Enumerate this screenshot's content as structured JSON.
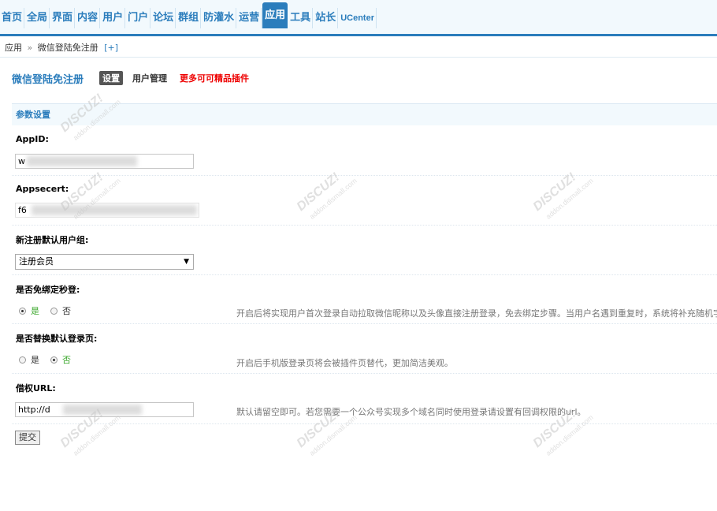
{
  "nav": {
    "items": [
      "首页",
      "全局",
      "界面",
      "内容",
      "用户",
      "门户",
      "论坛",
      "群组",
      "防灌水",
      "运营",
      "应用",
      "工具",
      "站长",
      "UCenter"
    ],
    "active": "应用"
  },
  "breadcrumb": {
    "root": "应用",
    "sep": "»",
    "current": "微信登陆免注册",
    "add": "[+]"
  },
  "plugin": {
    "title": "微信登陆免注册",
    "tab_settings": "设置",
    "tab_users": "用户管理",
    "more_link": "更多可可精品插件"
  },
  "section": {
    "title": "参数设置"
  },
  "fields": {
    "appid": {
      "label": "AppID:",
      "value": "w"
    },
    "secret": {
      "label": "Appsecert:",
      "value": "f6"
    },
    "group": {
      "label": "新注册默认用户组:",
      "value": "注册会员"
    },
    "skip_bind": {
      "label": "是否免绑定秒登:",
      "yes": "是",
      "no": "否",
      "tip": "开启后将实现用户首次登录自动拉取微信昵称以及头像直接注册登录，免去绑定步骤。当用户名遇到重复时，系统将补充随机字串组"
    },
    "replace_login": {
      "label": "是否替换默认登录页:",
      "yes": "是",
      "no": "否",
      "tip": "开启后手机版登录页将会被插件页替代，更加简洁美观。"
    },
    "borrow_url": {
      "label": "借权URL:",
      "value": "http://d",
      "tip": "默认请留空即可。若您需要一个公众号实现多个域名同时使用登录请设置有回调权限的url。"
    }
  },
  "submit_label": "提交",
  "watermark": {
    "brand": "DISCUZ!应用中心",
    "site": "addon.dismall.com",
    "author": "贰道"
  },
  "colors": {
    "accent": "#2b7dbc",
    "red": "#ee0000",
    "green": "#3ca82d"
  }
}
